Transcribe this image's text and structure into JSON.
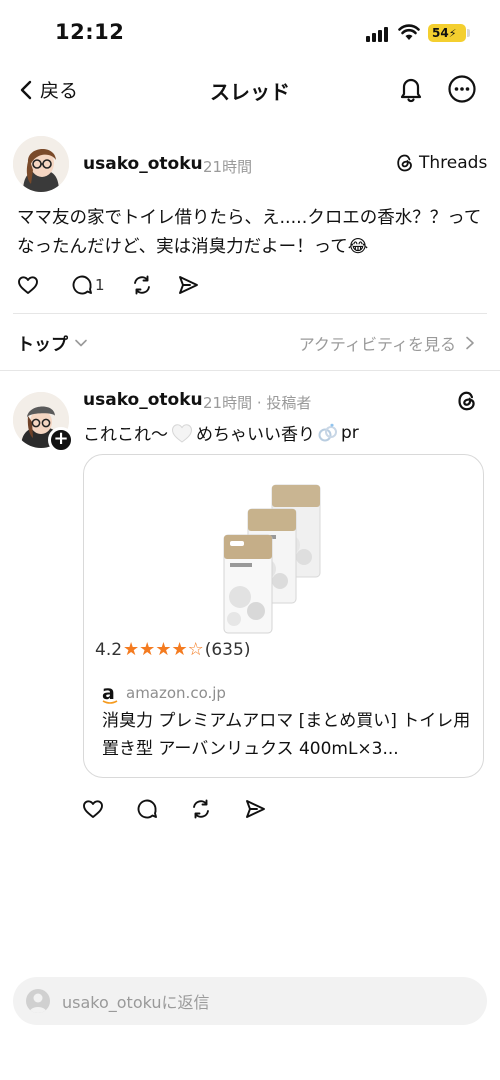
{
  "status_bar": {
    "time": "12:12",
    "battery": "54"
  },
  "nav": {
    "back_label": "戻る",
    "title": "スレッド"
  },
  "post": {
    "username": "usako_otoku",
    "time": "21時間",
    "threads_label": "Threads",
    "text": "ママ友の家でトイレ借りたら、え.....クロエの香水？？ってなったんだけど、実は消臭力だよー！って😂",
    "reply_count": "1"
  },
  "sort": {
    "label": "トップ",
    "activity_label": "アクティビティを見る"
  },
  "reply": {
    "username": "usako_otoku",
    "meta": "21時間 · 投稿者",
    "text_part1": "これこれ〜",
    "text_part2": "めちゃいい香り",
    "text_part3": "pr"
  },
  "link_card": {
    "rating": "4.2",
    "rating_value": 4.2,
    "stars": "★★★★☆",
    "review_count": "(635)",
    "domain": "amazon.co.jp",
    "logo_letter": "a",
    "title": "消臭力 プレミアムアロマ [まとめ買い] トイレ用 置き型 アーバンリュクス 400mL×3..."
  },
  "compose": {
    "placeholder": "usako_otokuに返信"
  },
  "colors": {
    "star": "#f47b20",
    "battery": "#f4cf2f",
    "muted_text": "#9a9a9a"
  }
}
